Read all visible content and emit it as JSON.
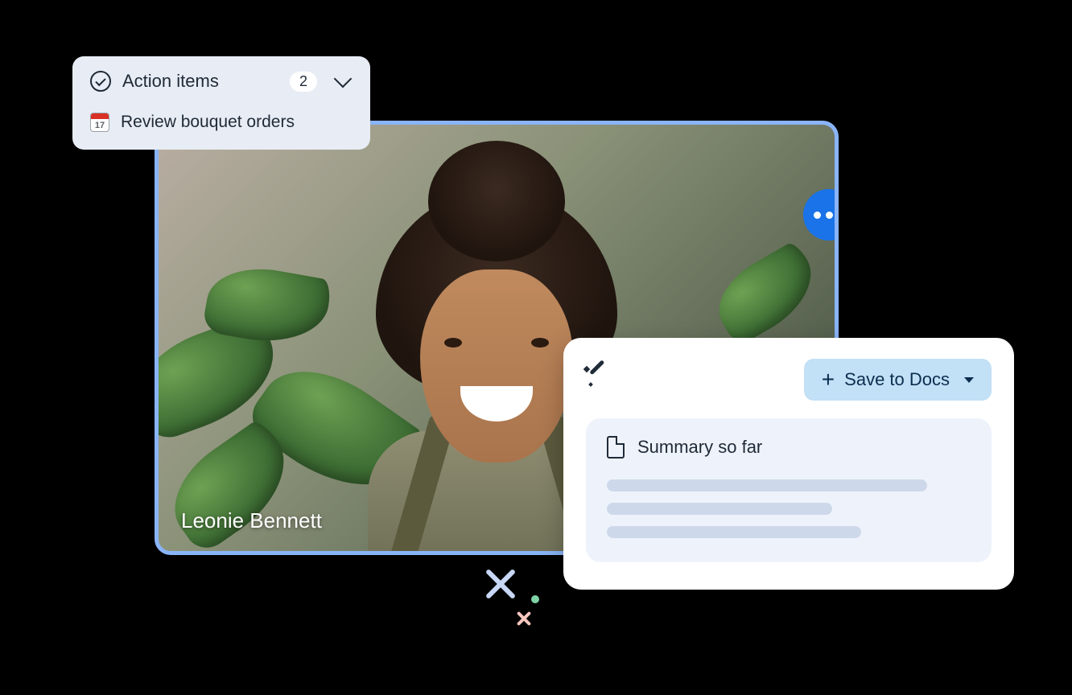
{
  "video": {
    "participant_name": "Leonie Bennett"
  },
  "action_items": {
    "title": "Action items",
    "count": "2",
    "items": [
      {
        "icon_day": "17",
        "text": "Review bouquet orders"
      }
    ]
  },
  "summary_card": {
    "save_button_label": "Save to Docs",
    "body_title": "Summary so far"
  }
}
